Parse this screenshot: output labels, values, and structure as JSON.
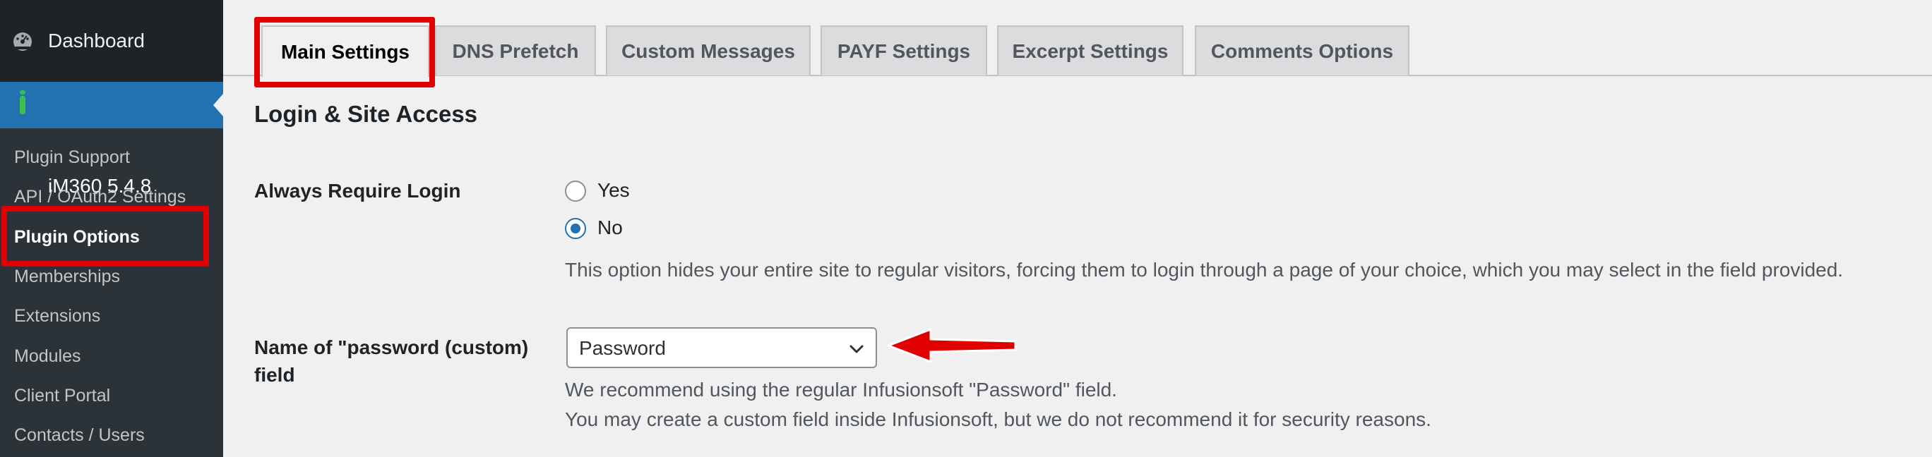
{
  "sidebar": {
    "dashboard_label": "Dashboard",
    "dashboard_icon": "dashboard-gauge-icon",
    "plugin_label": "iM360 5.4.8",
    "plugin_icon": "im360-info-icon",
    "items": [
      {
        "label": "Plugin Support",
        "active": false
      },
      {
        "label": "API / OAuth2 Settings",
        "active": false
      },
      {
        "label": "Plugin Options",
        "active": true
      },
      {
        "label": "Memberships",
        "active": false
      },
      {
        "label": "Extensions",
        "active": false
      },
      {
        "label": "Modules",
        "active": false
      },
      {
        "label": "Client Portal",
        "active": false
      },
      {
        "label": "Contacts / Users",
        "active": false
      }
    ]
  },
  "tabs": [
    {
      "label": "Main Settings",
      "active": true
    },
    {
      "label": "DNS Prefetch",
      "active": false
    },
    {
      "label": "Custom Messages",
      "active": false
    },
    {
      "label": "PAYF Settings",
      "active": false
    },
    {
      "label": "Excerpt Settings",
      "active": false
    },
    {
      "label": "Comments Options",
      "active": false
    }
  ],
  "main": {
    "section_title": "Login & Site Access",
    "require_login": {
      "label": "Always Require Login",
      "options": [
        "Yes",
        "No"
      ],
      "selected": "No",
      "description": "This option hides your entire site to regular visitors, forcing them to login through a page of your choice, which you may select in the field provided."
    },
    "password_field": {
      "label_line1": "Name of \"password (custom)",
      "label_line2": "field",
      "selected_value": "Password",
      "chevron_icon": "chevron-down-icon",
      "description_line1": "We recommend using the regular Infusionsoft \"Password\" field.",
      "description_line2": "You may create a custom field inside Infusionsoft, but we do not recommend it for security reasons."
    }
  },
  "annotations": {
    "highlight_color": "#e00000",
    "arrow_icon": "red-arrow-icon"
  },
  "colors": {
    "sidebar_bg": "#2c3338",
    "sidebar_top_bg": "#1d2327",
    "accent_blue": "#2271b1",
    "page_bg": "#f0f0f1"
  }
}
